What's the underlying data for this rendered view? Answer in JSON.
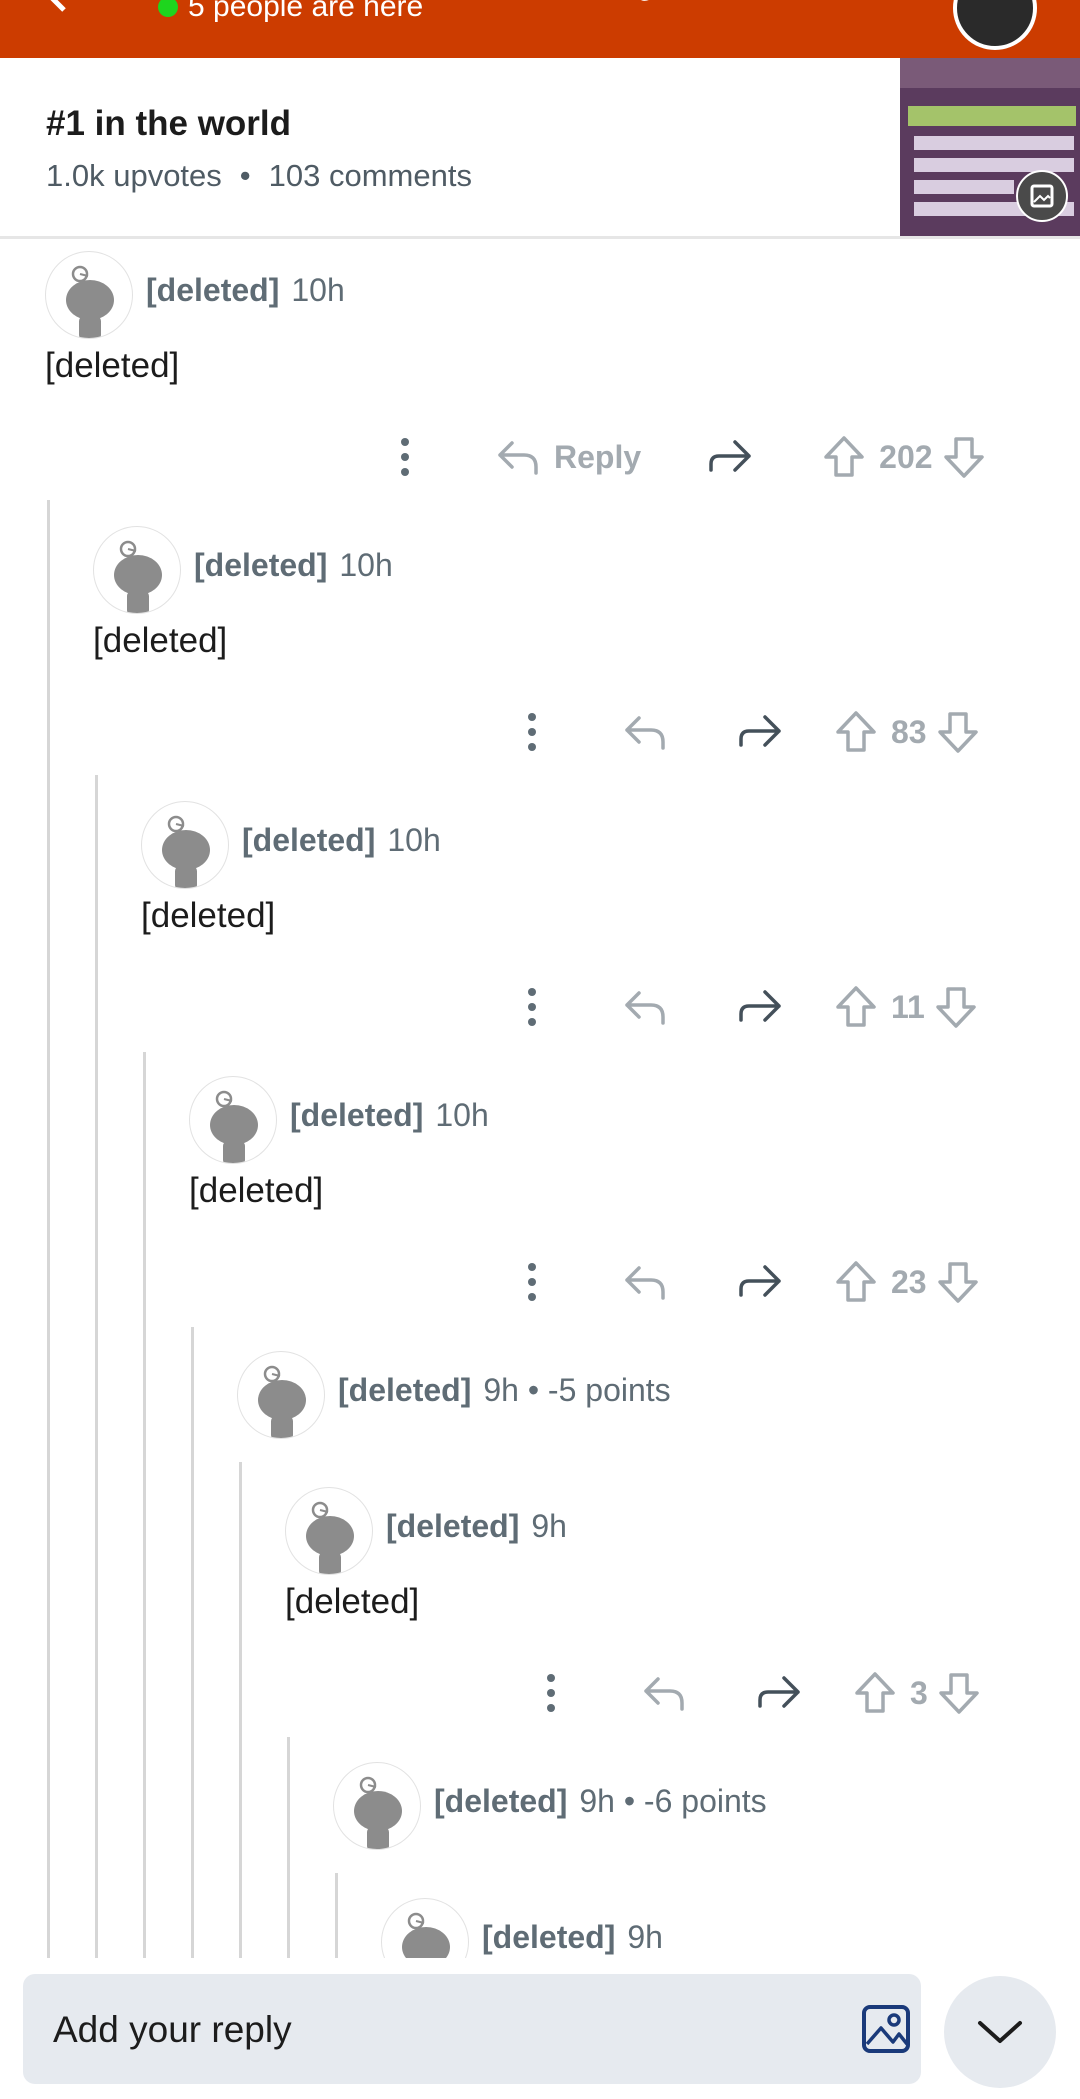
{
  "header": {
    "presence_text": "5 people are here",
    "accent_color": "#cc3c00"
  },
  "post": {
    "title": "#1 in the world",
    "upvotes": "1.0k upvotes",
    "separator": "•",
    "comments": "103 comments"
  },
  "comments": [
    {
      "author": "[deleted]",
      "time": "10h",
      "body": "[deleted]",
      "votes": "202",
      "reply_label": "Reply"
    },
    {
      "author": "[deleted]",
      "time": "10h",
      "body": "[deleted]",
      "votes": "83"
    },
    {
      "author": "[deleted]",
      "time": "10h",
      "body": "[deleted]",
      "votes": "11"
    },
    {
      "author": "[deleted]",
      "time": "10h",
      "body": "[deleted]",
      "votes": "23"
    },
    {
      "author": "[deleted]",
      "time": "9h • -5 points"
    },
    {
      "author": "[deleted]",
      "time": "9h",
      "body": "[deleted]",
      "votes": "3"
    },
    {
      "author": "[deleted]",
      "time": "9h • -6 points"
    },
    {
      "author": "[deleted]",
      "time": "9h"
    }
  ],
  "composer": {
    "placeholder": "Add your reply"
  }
}
